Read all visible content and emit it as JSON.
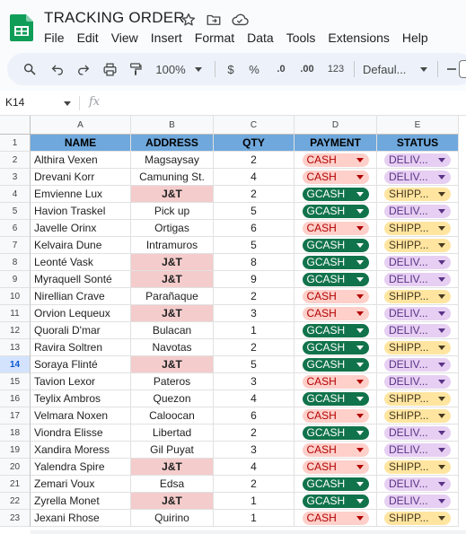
{
  "app": {
    "title": "TRACKING ORDER",
    "menu": [
      "File",
      "Edit",
      "View",
      "Insert",
      "Format",
      "Data",
      "Tools",
      "Extensions",
      "Help"
    ]
  },
  "toolbar": {
    "zoom": "100%",
    "currency": "$",
    "percent": "%",
    "decrease_decimal": ".0",
    "increase_decimal": ".00",
    "number_format": "123",
    "font": "Defaul...",
    "icons": [
      "search-icon",
      "undo-icon",
      "redo-icon",
      "print-icon",
      "paint-format-icon",
      "minus-icon"
    ]
  },
  "formula_bar": {
    "cell_ref": "K14",
    "fx": "fx",
    "value": ""
  },
  "grid": {
    "columns": [
      "A",
      "B",
      "C",
      "D",
      "E"
    ],
    "selected_row": 14,
    "header": [
      "NAME",
      "ADDRESS",
      "QTY",
      "PAYMENT",
      "STATUS"
    ],
    "rows": [
      [
        "Althira Vexen",
        "Magsaysay",
        "2",
        "CASH",
        "DELIV..."
      ],
      [
        "Drevani Korr",
        "Camuning St.",
        "4",
        "CASH",
        "DELIV..."
      ],
      [
        "Emvienne Lux",
        "J&T",
        "2",
        "GCASH",
        "SHIPP..."
      ],
      [
        "Havion Traskel",
        "Pick up",
        "5",
        "GCASH",
        "DELIV..."
      ],
      [
        "Javelle Orinx",
        "Ortigas",
        "6",
        "CASH",
        "SHIPP..."
      ],
      [
        "Kelvaira Dune",
        "Intramuros",
        "5",
        "GCASH",
        "SHIPP..."
      ],
      [
        "Leonté Vask",
        "J&T",
        "8",
        "GCASH",
        "DELIV..."
      ],
      [
        "Myraquell Sonté",
        "J&T",
        "9",
        "GCASH",
        "DELIV..."
      ],
      [
        "Nirellian Crave",
        "Parañaque",
        "2",
        "CASH",
        "SHIPP..."
      ],
      [
        "Orvion Lequeux",
        "J&T",
        "3",
        "CASH",
        "DELIV..."
      ],
      [
        "Quorali D'mar",
        "Bulacan",
        "1",
        "GCASH",
        "DELIV..."
      ],
      [
        "Ravira Soltren",
        "Navotas",
        "2",
        "GCASH",
        "SHIPP..."
      ],
      [
        "Soraya Flinté",
        "J&T",
        "5",
        "GCASH",
        "DELIV..."
      ],
      [
        "Tavion Lexor",
        "Pateros",
        "3",
        "CASH",
        "DELIV..."
      ],
      [
        "Teylix Ambros",
        "Quezon",
        "4",
        "GCASH",
        "SHIPP..."
      ],
      [
        "Velmara Noxen",
        "Caloocan",
        "6",
        "CASH",
        "SHIPP..."
      ],
      [
        "Viondra Elisse",
        "Libertad",
        "2",
        "GCASH",
        "DELIV..."
      ],
      [
        "Xandira Moress",
        "Gil Puyat",
        "3",
        "CASH",
        "DELIV..."
      ],
      [
        "Yalendra Spire",
        "J&T",
        "4",
        "CASH",
        "SHIPP..."
      ],
      [
        "Zemari Voux",
        "Edsa",
        "2",
        "GCASH",
        "DELIV..."
      ],
      [
        "Zyrella Monet",
        "J&T",
        "1",
        "GCASH",
        "DELIV..."
      ],
      [
        "Jexani Rhose",
        "Quirino",
        "1",
        "CASH",
        "SHIPP..."
      ]
    ]
  },
  "colors": {
    "header_fill": "#6fa8dc",
    "jt_fill": "#f4cccc",
    "cash_chip": "#ffcfc9",
    "gcash_chip": "#11734b",
    "deliv_chip": "#e6cff2",
    "shipp_chip": "#ffe5a0",
    "logo_green": "#0f9d58"
  }
}
